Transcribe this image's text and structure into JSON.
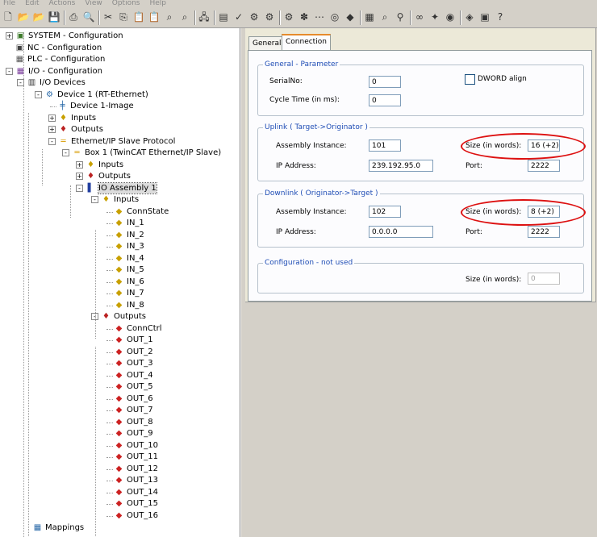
{
  "menu": [
    "File",
    "Edit",
    "Actions",
    "View",
    "Options",
    "Help"
  ],
  "toolbar_icons": [
    "new-icon",
    "open-icon",
    "open-folder-icon",
    "save-icon",
    "|",
    "print-icon",
    "print-preview-icon",
    "|",
    "cut-icon",
    "copy-icon",
    "paste-icon",
    "paste-special-icon",
    "find-icon",
    "find-next-icon",
    "|",
    "network-icon",
    "|",
    "build-icon",
    "check-icon",
    "activate-icon",
    "config-mode-icon",
    "|",
    "run-mode-icon",
    "free-run-icon",
    "scan-icon",
    "target-icon",
    "insert-icon",
    "|",
    "list-icon",
    "zoom-icon",
    "search-device-icon",
    "|",
    "watch-icon",
    "add-var-icon",
    "toggle-icon",
    "|",
    "book-icon",
    "help-book-icon",
    "help-icon"
  ],
  "tree": {
    "nodes": [
      {
        "label": "SYSTEM - Configuration",
        "level": 0,
        "exp": "+",
        "icon": "system-icon"
      },
      {
        "label": "NC - Configuration",
        "level": 0,
        "exp": "",
        "icon": "nc-icon"
      },
      {
        "label": "PLC - Configuration",
        "level": 0,
        "exp": "",
        "icon": "plc-icon"
      },
      {
        "label": "I/O - Configuration",
        "level": 0,
        "exp": "-",
        "icon": "io-config-icon"
      },
      {
        "label": "I/O Devices",
        "level": 1,
        "exp": "-",
        "icon": "io-devices-icon"
      },
      {
        "label": "Device 1 (RT-Ethernet)",
        "level": 2,
        "exp": "-",
        "icon": "ethernet-device-icon"
      },
      {
        "label": "Device 1-Image",
        "level": 3,
        "exp": "",
        "icon": "image-icon"
      },
      {
        "label": "Inputs",
        "level": 3,
        "exp": "+",
        "icon": "inputs-icon"
      },
      {
        "label": "Outputs",
        "level": 3,
        "exp": "+",
        "icon": "outputs-icon"
      },
      {
        "label": "Ethernet/IP Slave Protocol",
        "level": 3,
        "exp": "-",
        "icon": "protocol-icon"
      },
      {
        "label": "Box 1 (TwinCAT Ethernet/IP Slave)",
        "level": 4,
        "exp": "-",
        "icon": "box-icon"
      },
      {
        "label": "Inputs",
        "level": 5,
        "exp": "+",
        "icon": "inputs-icon"
      },
      {
        "label": "Outputs",
        "level": 5,
        "exp": "+",
        "icon": "outputs-icon"
      },
      {
        "label": "IO Assembly 1",
        "level": 5,
        "exp": "-",
        "icon": "assembly-icon",
        "selected": true
      },
      {
        "label": "Inputs",
        "level": 6,
        "exp": "-",
        "icon": "inputs-icon"
      },
      {
        "label": "ConnState",
        "level": 7,
        "exp": "",
        "icon": "input-var-icon"
      },
      {
        "label": "IN_1",
        "level": 7,
        "exp": "",
        "icon": "input-var-icon"
      },
      {
        "label": "IN_2",
        "level": 7,
        "exp": "",
        "icon": "input-var-icon"
      },
      {
        "label": "IN_3",
        "level": 7,
        "exp": "",
        "icon": "input-var-icon"
      },
      {
        "label": "IN_4",
        "level": 7,
        "exp": "",
        "icon": "input-var-icon"
      },
      {
        "label": "IN_5",
        "level": 7,
        "exp": "",
        "icon": "input-var-icon"
      },
      {
        "label": "IN_6",
        "level": 7,
        "exp": "",
        "icon": "input-var-icon"
      },
      {
        "label": "IN_7",
        "level": 7,
        "exp": "",
        "icon": "input-var-icon"
      },
      {
        "label": "IN_8",
        "level": 7,
        "exp": "",
        "icon": "input-var-icon"
      },
      {
        "label": "Outputs",
        "level": 6,
        "exp": "-",
        "icon": "outputs-icon"
      },
      {
        "label": "ConnCtrl",
        "level": 7,
        "exp": "",
        "icon": "output-var-icon"
      },
      {
        "label": "OUT_1",
        "level": 7,
        "exp": "",
        "icon": "output-var-icon"
      },
      {
        "label": "OUT_2",
        "level": 7,
        "exp": "",
        "icon": "output-var-icon"
      },
      {
        "label": "OUT_3",
        "level": 7,
        "exp": "",
        "icon": "output-var-icon"
      },
      {
        "label": "OUT_4",
        "level": 7,
        "exp": "",
        "icon": "output-var-icon"
      },
      {
        "label": "OUT_5",
        "level": 7,
        "exp": "",
        "icon": "output-var-icon"
      },
      {
        "label": "OUT_6",
        "level": 7,
        "exp": "",
        "icon": "output-var-icon"
      },
      {
        "label": "OUT_7",
        "level": 7,
        "exp": "",
        "icon": "output-var-icon"
      },
      {
        "label": "OUT_8",
        "level": 7,
        "exp": "",
        "icon": "output-var-icon"
      },
      {
        "label": "OUT_9",
        "level": 7,
        "exp": "",
        "icon": "output-var-icon"
      },
      {
        "label": "OUT_10",
        "level": 7,
        "exp": "",
        "icon": "output-var-icon"
      },
      {
        "label": "OUT_11",
        "level": 7,
        "exp": "",
        "icon": "output-var-icon"
      },
      {
        "label": "OUT_12",
        "level": 7,
        "exp": "",
        "icon": "output-var-icon"
      },
      {
        "label": "OUT_13",
        "level": 7,
        "exp": "",
        "icon": "output-var-icon"
      },
      {
        "label": "OUT_14",
        "level": 7,
        "exp": "",
        "icon": "output-var-icon"
      },
      {
        "label": "OUT_15",
        "level": 7,
        "exp": "",
        "icon": "output-var-icon"
      },
      {
        "label": "OUT_16",
        "level": 7,
        "exp": "",
        "icon": "output-var-icon"
      }
    ],
    "mappings": {
      "label": "Mappings",
      "icon": "mappings-icon"
    }
  },
  "tabs": [
    {
      "label": "General",
      "active": false
    },
    {
      "label": "Connection",
      "active": true
    }
  ],
  "general": {
    "title": "General - Parameter",
    "serial_label": "SerialNo:",
    "serial_value": "0",
    "dword_label": "DWORD align",
    "dword_checked": false,
    "cycle_label": "Cycle Time (in ms):",
    "cycle_value": "0"
  },
  "uplink": {
    "title": "Uplink ( Target->Originator )",
    "assembly_label": "Assembly Instance:",
    "assembly_value": "101",
    "size_label": "Size (in words):",
    "size_value": "16 (+2)",
    "ip_label": "IP Address:",
    "ip_value": "239.192.95.0",
    "port_label": "Port:",
    "port_value": "2222"
  },
  "downlink": {
    "title": "Downlink ( Originator->Target )",
    "assembly_label": "Assembly Instance:",
    "assembly_value": "102",
    "size_label": "Size (in words):",
    "size_value": "8 (+2)",
    "ip_label": "IP Address:",
    "ip_value": "0.0.0.0",
    "port_label": "Port:",
    "port_value": "2222"
  },
  "config": {
    "title": "Configuration - not used",
    "size_label": "Size (in words):",
    "size_value": "0"
  },
  "colors": {
    "highlight_ellipse": "#dd1111",
    "group_title": "#1f4db5",
    "tab_accent": "#e68b2c"
  }
}
